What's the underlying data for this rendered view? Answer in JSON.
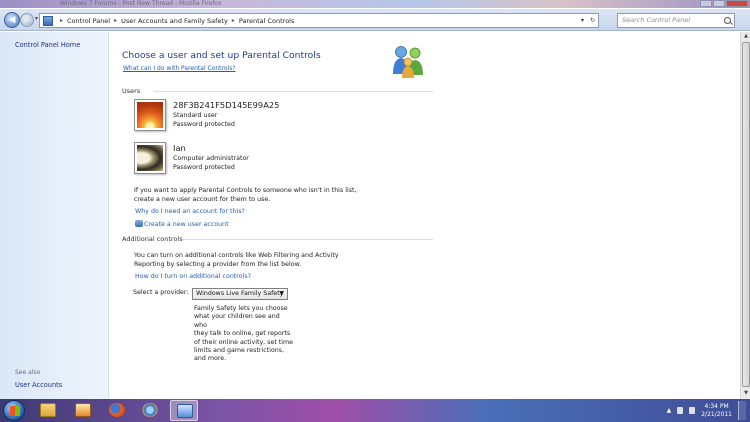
{
  "window": {
    "title_ghost": "Windows 7 Forums - Post New Thread - Mozilla Firefox"
  },
  "address_bar": {
    "breadcrumbs": [
      "Control Panel",
      "User Accounts and Family Safety",
      "Parental Controls"
    ],
    "search_placeholder": "Search Control Panel"
  },
  "sidebar": {
    "home_link": "Control Panel Home",
    "see_also_label": "See also",
    "see_also_link": "User Accounts"
  },
  "main": {
    "heading": "Choose a user and set up Parental Controls",
    "help_link": "What can I do with Parental Controls?",
    "users_label": "Users",
    "users": [
      {
        "name": "28F3B241F5D145E99A25",
        "role": "Standard user",
        "status": "Password protected",
        "picture": "orange-flower-picture"
      },
      {
        "name": "Ian",
        "role": "Computer administrator",
        "status": "Password protected",
        "picture": "abstract-curve-picture"
      }
    ],
    "no_account_text_1": "If you want to apply Parental Controls to someone who isn't in this list,",
    "no_account_text_2": "create a new user account for them to use.",
    "why_account_link": "Why do I need an account for this?",
    "create_account_link": "Create a new user account",
    "additional_label": "Additional controls",
    "additional_text_1": "You can turn on additional controls like Web Filtering and Activity",
    "additional_text_2": "Reporting by selecting a provider from the list below.",
    "how_turn_on_link": "How do I turn on additional controls?",
    "provider_label": "Select a provider:",
    "provider_selected": "Windows Live Family Safety",
    "provider_desc": [
      "Family Safety lets you choose",
      "what your children see and who",
      "they talk to online, get reports",
      "of their online activity, set time",
      "limits and game restrictions,",
      "and more."
    ]
  },
  "taskbar": {
    "apps": [
      "explorer-icon",
      "media-player-icon",
      "firefox-icon",
      "ie-icon",
      "control-panel-icon"
    ],
    "time": "4:34 PM",
    "date": "2/21/2011"
  },
  "colors": {
    "heading": "#1e3d8f",
    "link": "#1f5fb0",
    "sidebar_bg": "#dbe7f7"
  }
}
